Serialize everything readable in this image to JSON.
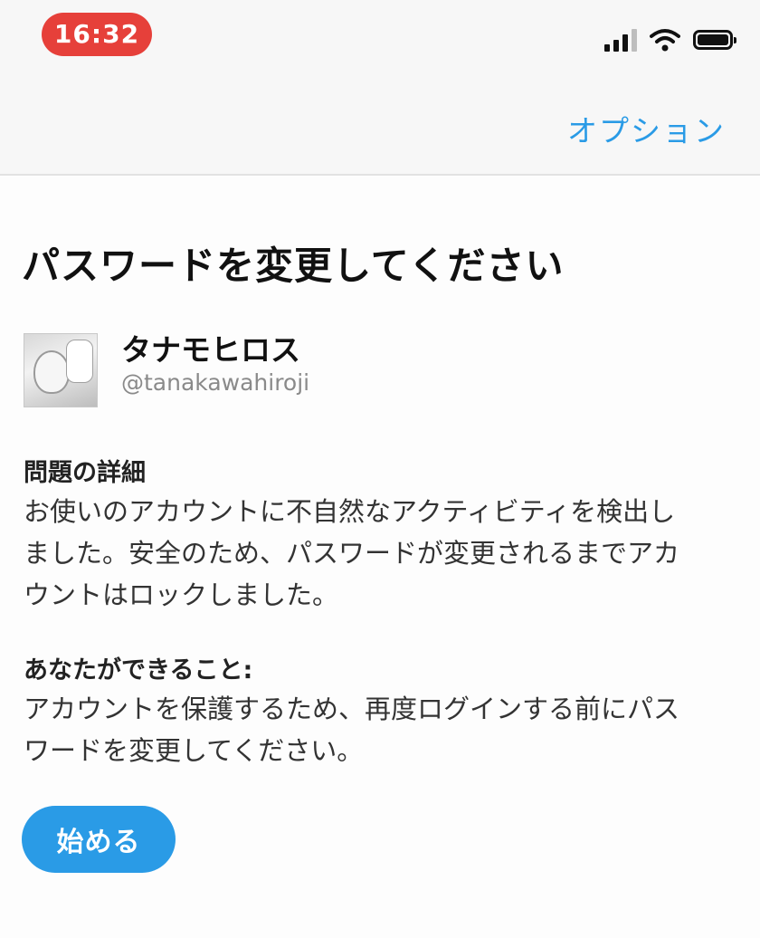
{
  "status_bar": {
    "time": "16:32",
    "icons": [
      "signal-icon",
      "wifi-icon",
      "battery-icon"
    ],
    "time_pill_color": "#e6403a"
  },
  "nav": {
    "options_label": "オプション"
  },
  "page": {
    "title": "パスワードを変更してください"
  },
  "account": {
    "display_name": "タナモヒロス",
    "username": "@tanakawahiroji"
  },
  "details": {
    "heading": "問題の詳細",
    "lines": [
      "お使いのアカウントに不自然なアクティビティを検出し",
      "ました。安全のため、パスワードが変更されるまでアカ",
      "ウントはロックしました。"
    ]
  },
  "actions": {
    "heading": "あなたができること:",
    "lines": [
      "アカウントを保護するため、再度ログインする前にパス",
      "ワードを変更してください。"
    ]
  },
  "start_button": {
    "label": "始める"
  },
  "colors": {
    "accent": "#2a9be6",
    "background": "#fdfdfd",
    "nav_background": "#f7f7f7"
  }
}
